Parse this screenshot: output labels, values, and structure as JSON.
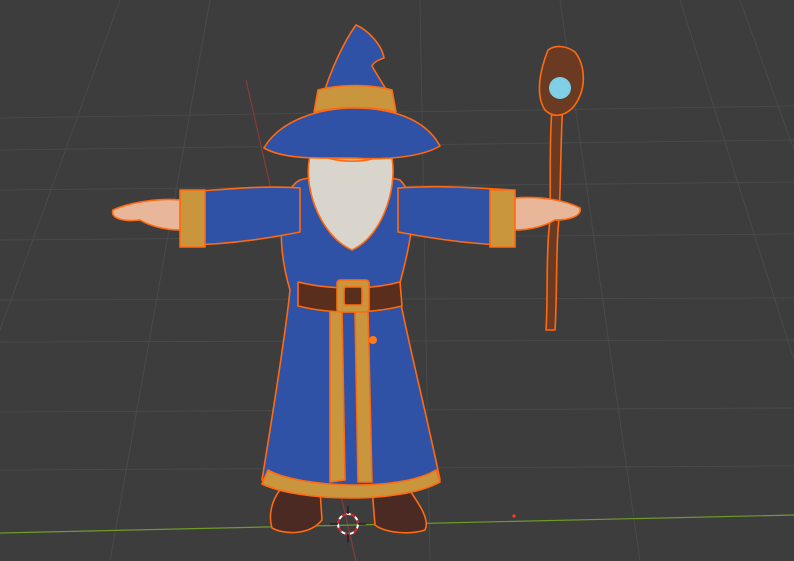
{
  "viewport": {
    "background": "#3d3d3d",
    "grid_color": "#4a4a4a",
    "grid_visible": true,
    "axis_x_color": "#6e9a2c",
    "axis_y_color": "#8a3a3a"
  },
  "selection": {
    "outline_color": "#ff6a10",
    "origin_color": "#ff7a1a"
  },
  "model": {
    "robe_color": "#2f52a6",
    "robe_shadow": "#233f86",
    "trim_color": "#c9963e",
    "skin_color": "#e8b79a",
    "beard_color": "#d9d4cc",
    "belt_color": "#5a2e1c",
    "boot_color": "#4a2a22",
    "staff_color": "#6a3a22",
    "gem_color": "#7fd0e6"
  },
  "cursor": {
    "icon": "3d-cursor-icon"
  }
}
